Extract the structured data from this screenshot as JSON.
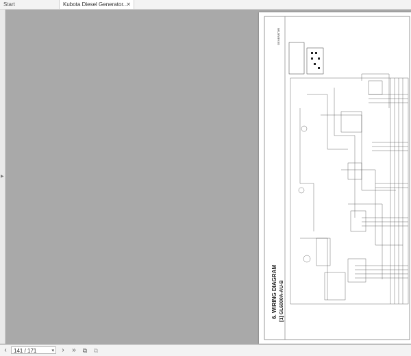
{
  "tabs": [
    {
      "label": "Start"
    },
    {
      "label": "Kubota Diesel Generator..."
    }
  ],
  "document": {
    "section_title": "6.  WIRING DIAGRAM",
    "subsection_title": "[1]  GL6000A-AU-B",
    "header_text": "GENERATOR"
  },
  "status": {
    "page_indicator": "141 / 171"
  },
  "colors": {
    "background": "#a9a9a9",
    "page": "#ffffff",
    "toolbar": "#f3f3f3"
  }
}
